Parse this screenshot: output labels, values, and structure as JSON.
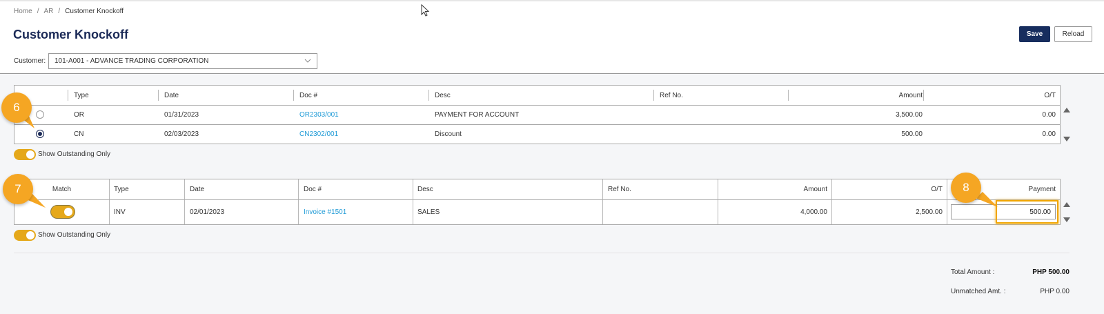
{
  "breadcrumb": {
    "home": "Home",
    "sep1": "/",
    "ar": "AR",
    "sep2": "/",
    "current": "Customer Knockoff"
  },
  "page_title": "Customer Knockoff",
  "toolbar": {
    "save_label": "Save",
    "reload_label": "Reload"
  },
  "customer": {
    "label": "Customer:",
    "value": "101-A001 - ADVANCE TRADING CORPORATION"
  },
  "credits_table": {
    "columns": [
      "Type",
      "Date",
      "Doc #",
      "Desc",
      "Ref No.",
      "Amount",
      "O/T"
    ],
    "rows": [
      {
        "selected": false,
        "type": "OR",
        "date": "01/31/2023",
        "doc": "OR2303/001",
        "desc": "PAYMENT FOR ACCOUNT",
        "ref": "",
        "amount": "3,500.00",
        "ot": "0.00"
      },
      {
        "selected": true,
        "type": "CN",
        "date": "02/03/2023",
        "doc": "CN2302/001",
        "desc": "Discount",
        "ref": "",
        "amount": "500.00",
        "ot": "0.00"
      }
    ],
    "toggle_label": "Show Outstanding Only"
  },
  "invoices_table": {
    "columns": [
      "Match",
      "Type",
      "Date",
      "Doc #",
      "Desc",
      "Ref No.",
      "Amount",
      "O/T",
      "Payment"
    ],
    "rows": [
      {
        "match": true,
        "type": "INV",
        "date": "02/01/2023",
        "doc": "Invoice #1501",
        "desc": "SALES",
        "ref": "",
        "amount": "4,000.00",
        "ot": "2,500.00",
        "payment": "500.00"
      }
    ],
    "toggle_label": "Show Outstanding Only"
  },
  "totals": {
    "total_amount_label": "Total Amount :",
    "total_amount_value": "PHP 500.00",
    "unmatched_label": "Unmatched Amt. :",
    "unmatched_value": "PHP 0.00"
  },
  "callouts": {
    "c6": "6",
    "c7": "7",
    "c8": "8"
  },
  "colors": {
    "accent": "#e5a81a",
    "brand": "#172d5e",
    "link": "#1e9ad6",
    "callout": "#f5a623"
  },
  "icons": {
    "dropdown": "chevron-down-icon",
    "scroll_up": "scroll-up-arrow-icon",
    "scroll_down": "scroll-down-arrow-icon",
    "cursor": "mouse-pointer-icon"
  }
}
